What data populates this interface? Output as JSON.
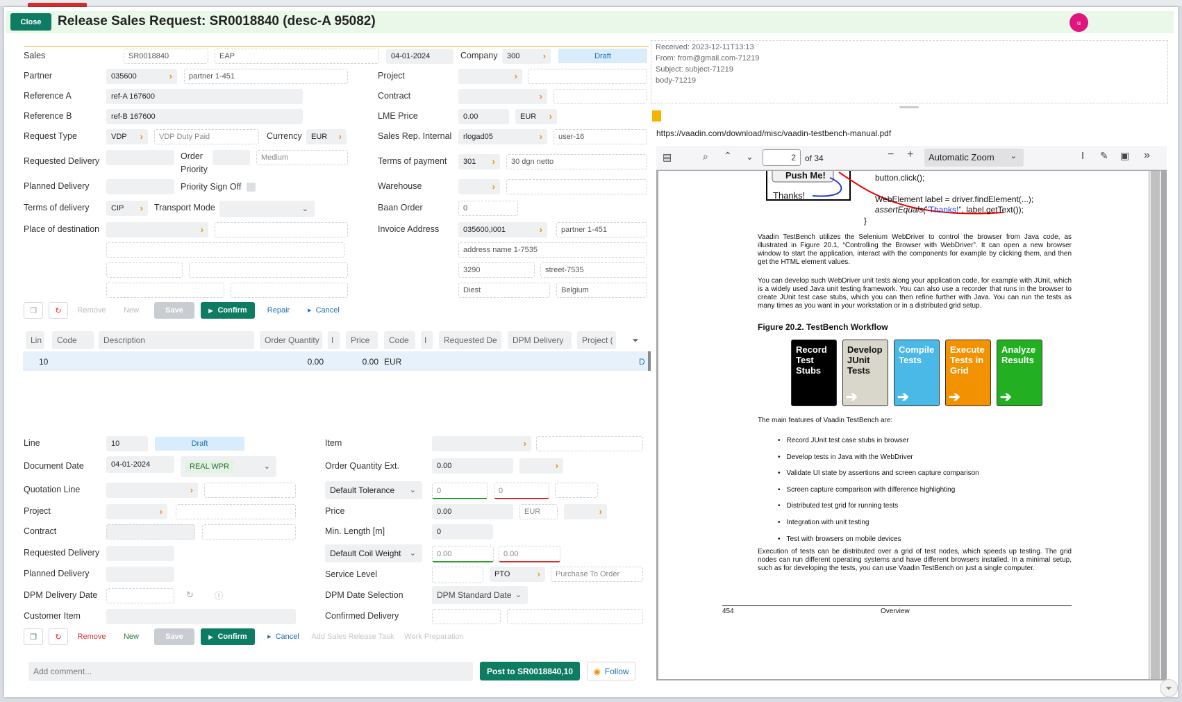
{
  "window": {
    "close_label": "Close",
    "title": "Release Sales Request: SR0018840 (desc-A 95082)",
    "avatar_letter": "u"
  },
  "header": {
    "sales_label": "Sales",
    "sales_no": "SR0018840",
    "sales_type": "EAP",
    "date": "04-01-2024",
    "company_label": "Company",
    "company": "300",
    "status": "Draft"
  },
  "left_form": {
    "partner_label": "Partner",
    "partner_code": "035600",
    "partner_name": "partner 1-451",
    "refa_label": "Reference A",
    "refa": "ref-A 167600",
    "refb_label": "Reference B",
    "refb": "ref-B 167600",
    "reqtype_label": "Request Type",
    "reqtype": "VDP",
    "reqtype_desc": "VDP Duty Paid",
    "currency_label": "Currency",
    "currency": "EUR",
    "reqdel_label": "Requested Delivery",
    "order_priority_label1": "Order",
    "order_priority_label2": "Priority",
    "order_priority": "Medium",
    "planned_label": "Planned Delivery",
    "priority_signoff_label": "Priority Sign Off",
    "terms_label": "Terms of delivery",
    "terms": "CIP",
    "transport_label": "Transport Mode",
    "place_label": "Place of destination"
  },
  "right_form": {
    "project_label": "Project",
    "contract_label": "Contract",
    "lme_label": "LME Price",
    "lme": "0.00",
    "lme_cur": "EUR",
    "salesrep_label": "Sales Rep. Internal",
    "salesrep": "rlogad05",
    "salesrep_user": "user-16",
    "payment_label": "Terms of payment",
    "payment": "301",
    "payment_desc": "30 dgn netto",
    "warehouse_label": "Warehouse",
    "baan_label": "Baan Order",
    "baan": "0",
    "invoice_label": "Invoice Address",
    "invoice": "035600,I001",
    "invoice_partner": "partner 1-451",
    "address_name": "address name 1-7535",
    "zip": "3290",
    "street": "street-7535",
    "city": "Diest",
    "country": "Belgium"
  },
  "toolbar1": {
    "remove": "Remove",
    "new": "New",
    "save": "Save",
    "confirm": "Confirm",
    "repair": "Repair",
    "cancel": "Cancel"
  },
  "grid": {
    "columns": [
      "Lin",
      "Code",
      "Description",
      "Order Quantity",
      "I",
      "Price",
      "Code",
      "I",
      "Requested De",
      "DPM Delivery",
      "Project ("
    ],
    "row": {
      "line": "10",
      "qty": "0.00",
      "price": "0.00",
      "cur": "EUR",
      "tail": "D"
    }
  },
  "line_form": {
    "line_label": "Line",
    "line": "10",
    "line_status": "Draft",
    "docdate_label": "Document Date",
    "docdate": "04-01-2024",
    "wpr": "REAL WPR",
    "quotation_label": "Quotation Line",
    "project_label": "Project",
    "contract_label": "Contract",
    "reqdel_label": "Requested Delivery",
    "planned_label": "Planned Delivery",
    "dpmdate_label": "DPM Delivery Date",
    "custitem_label": "Customer Item",
    "item_label": "Item",
    "oqe_label": "Order Quantity Ext.",
    "oqe": "0.00",
    "tolerance": "Default Tolerance",
    "tol_min": "0",
    "tol_max": "0",
    "price_label": "Price",
    "price": "0.00",
    "price_cur": "EUR",
    "minlen_label": "Min. Length [m]",
    "minlen": "0",
    "coil": "Default Coil Weight",
    "coil_min": "0.00",
    "coil_max": "0.00",
    "service_label": "Service Level",
    "service": "PTO",
    "service_desc": "Purchase To Order",
    "dpmsel_label": "DPM Date Selection",
    "dpmsel": "DPM Standard Date",
    "confirmed_label": "Confirmed Delivery"
  },
  "toolbar2": {
    "remove": "Remove",
    "new": "New",
    "save": "Save",
    "confirm": "Confirm",
    "cancel": "Cancel",
    "task": "Add Sales Release Task",
    "prep": "Work Preparation"
  },
  "footer": {
    "comment_placeholder": "Add comment...",
    "post": "Post to SR0018840,10",
    "follow": "Follow"
  },
  "mail": {
    "received": "Received: 2023-12-11T13:13",
    "from": "From: from@gmail.com-71219",
    "subject": "Subject: subject-71219",
    "body": "body-71219"
  },
  "pdf": {
    "url": "https://vaadin.com/download/misc/vaadin-testbench-manual.pdf",
    "page": "2",
    "of": "of 34",
    "zoom": "Automatic Zoom",
    "code": {
      "push": "Push Me!",
      "thanks": "Thanks!",
      "c1": "button.click();",
      "c2": "WebElement label = driver.findElement(...);",
      "c3a": "assertEquals(",
      "c3b": "\"Thanks!\"",
      "c3c": ", label.getText());",
      "c4": "}"
    },
    "p1": "Vaadin TestBench utilizes the Selenium WebDriver to control the browser from Java code, as illustrated in Figure 20.1, “Controlling the Browser with WebDriver”. It can open a new browser window to start the application, interact with the components for example by clicking them, and then get the HTML element values.",
    "p2": "You can develop such WebDriver unit tests along your application code, for example with JUnit, which is a widely used Java unit testing framework. You can also use a recorder that runs in the browser to create JUnit test case stubs, which you can then refine further with Java. You can run the tests as many times as you want in your workstation or in a distributed grid setup.",
    "fig_title": "Figure 20.2. TestBench Workflow",
    "workflow": [
      {
        "label": "Record Test Stubs",
        "color": "#000000",
        "text": "#ffffff"
      },
      {
        "label": "Develop JUnit Tests",
        "color": "#d9d7cc",
        "text": "#111111"
      },
      {
        "label": "Compile Tests",
        "color": "#4bb9e8",
        "text": "#ffffff"
      },
      {
        "label": "Execute Tests in Grid",
        "color": "#f39200",
        "text": "#ffffff"
      },
      {
        "label": "Analyze Results",
        "color": "#22b022",
        "text": "#ffffff"
      }
    ],
    "features_intro": "The main features of Vaadin TestBench are:",
    "features": [
      "Record JUnit test case stubs in browser",
      "Develop tests in Java with the WebDriver",
      "Validate UI state by assertions and screen capture comparison",
      "Screen capture comparison with difference highlighting",
      "Distributed test grid for running tests",
      "Integration with unit testing",
      "Test with browsers on mobile devices"
    ],
    "p3": "Execution of tests can be distributed over a grid of test nodes, which speeds up testing. The grid nodes can run different operating systems and have different browsers installed. In a minimal setup, such as for developing the tests, you can use Vaadin TestBench on just a single computer.",
    "page_no": "454",
    "section": "Overview"
  }
}
